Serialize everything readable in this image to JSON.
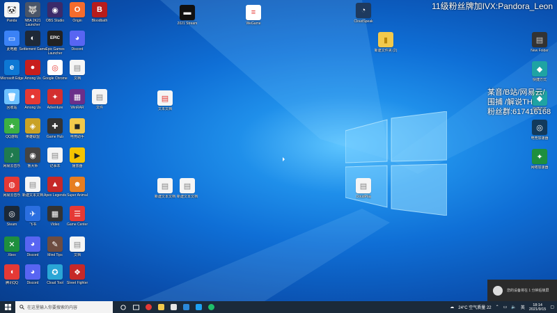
{
  "desktop": {
    "icons": [
      {
        "label": "Panda",
        "color": "#f5f5f5",
        "glyph": "🐼"
      },
      {
        "label": "NBA 2K21 Launcher",
        "color": "#4a5568",
        "glyph": "🐺"
      },
      {
        "label": "OBS Studio",
        "color": "#3b2a6a",
        "glyph": "◉"
      },
      {
        "label": "Origin",
        "color": "#f56c2d",
        "glyph": "O"
      },
      {
        "label": "Bloodbath",
        "color": "#b71c1c",
        "glyph": "B"
      },
      {
        "label": "2021 Stream",
        "color": "#111111",
        "glyph": "▬"
      },
      {
        "label": "WeGame",
        "color": "#ffffff",
        "glyph": "≡"
      },
      {
        "label": "CloudSpeak",
        "color": "#1e3a5f",
        "glyph": "◔"
      },
      {
        "label": "此电脑",
        "color": "#3b82f6",
        "glyph": "▭"
      },
      {
        "label": "Settlement Game",
        "color": "#1f2937",
        "glyph": "◐"
      },
      {
        "label": "Epic Games Launcher",
        "color": "#222222",
        "glyph": "EPIC"
      },
      {
        "label": "Discord",
        "color": "#5865f2",
        "glyph": "◕"
      },
      {
        "label": "新建文件夹 (2)",
        "color": "#f2c94c",
        "glyph": "▮"
      },
      {
        "label": "New Folder",
        "color": "#f5f5f5",
        "glyph": "▤"
      },
      {
        "label": "Microsoft Edge",
        "color": "#0e78d4",
        "glyph": "e"
      },
      {
        "label": "Among Us",
        "color": "#c81e1e",
        "glyph": "●"
      },
      {
        "label": "Google Chrome",
        "color": "#ffffff",
        "glyph": "◎"
      },
      {
        "label": "文档",
        "color": "#f5f5f5",
        "glyph": "▤"
      },
      {
        "label": "快捷方式",
        "color": "#1fa3a3",
        "glyph": "◆"
      },
      {
        "label": "回收站",
        "color": "#6ec1ff",
        "glyph": "🗑"
      },
      {
        "label": "Among Us",
        "color": "#e53935",
        "glyph": "●"
      },
      {
        "label": "Adventure",
        "color": "#d32f2f",
        "glyph": "✦"
      },
      {
        "label": "WinRAR",
        "color": "#6b2f8a",
        "glyph": "▦"
      },
      {
        "label": "文件",
        "color": "#f5f5f5",
        "glyph": "▤"
      },
      {
        "label": "文本文档",
        "color": "#f5f5f5",
        "glyph": "▤"
      },
      {
        "label": "QQ游戏",
        "color": "#3cb043",
        "glyph": "★"
      },
      {
        "label": "英雄联盟",
        "color": "#c9a227",
        "glyph": "◈"
      },
      {
        "label": "Game Hub",
        "color": "#333333",
        "glyph": "✚"
      },
      {
        "label": "电竞助手",
        "color": "#f2c94c",
        "glyph": "◼"
      },
      {
        "label": "网易云音乐",
        "color": "#1f7a4f",
        "glyph": "♪"
      },
      {
        "label": "鲁大师",
        "color": "#444444",
        "glyph": "◉"
      },
      {
        "label": "记事本",
        "color": "#f5f5f5",
        "glyph": "▤"
      },
      {
        "label": "播放器",
        "color": "#f5c400",
        "glyph": "▶"
      },
      {
        "label": "网易云音乐",
        "color": "#e53935",
        "glyph": "◍"
      },
      {
        "label": "新建文本文档",
        "color": "#f5f5f5",
        "glyph": "▤"
      },
      {
        "label": "Apex Legends",
        "color": "#c62828",
        "glyph": "▲"
      },
      {
        "label": "Super Animal",
        "color": "#e67e22",
        "glyph": "☻"
      },
      {
        "label": "文档",
        "color": "#f5f5f5",
        "glyph": "▤"
      },
      {
        "label": "Steam",
        "color": "#1b2838",
        "glyph": "◎"
      },
      {
        "label": "飞书",
        "color": "#2b6fe0",
        "glyph": "✈"
      },
      {
        "label": "Video",
        "color": "#333333",
        "glyph": "▦"
      },
      {
        "label": "Game Center",
        "color": "#e53935",
        "glyph": "☰"
      },
      {
        "label": "Xbox",
        "color": "#1e8f3e",
        "glyph": "✕"
      },
      {
        "label": "Discord",
        "color": "#5865f2",
        "glyph": "◕"
      },
      {
        "label": "Mind Tips",
        "color": "#6d4c41",
        "glyph": "✎"
      },
      {
        "label": "文档",
        "color": "#f5f5f5",
        "glyph": "▤"
      },
      {
        "label": "腾讯QQ",
        "color": "#e53935",
        "glyph": "◖"
      },
      {
        "label": "Discord",
        "color": "#5865f2",
        "glyph": "◕"
      },
      {
        "label": "Cloud Tool",
        "color": "#2aa6d6",
        "glyph": "✪"
      },
      {
        "label": "Street Fighter",
        "color": "#c62828",
        "glyph": "❖"
      },
      {
        "label": "快捷方式",
        "color": "#1fa3a3",
        "glyph": "◆"
      },
      {
        "label": "电竞加速器",
        "color": "#123a5c",
        "glyph": "◎"
      },
      {
        "label": "网络加速器",
        "color": "#1e8f3e",
        "glyph": "✦"
      },
      {
        "label": "素材",
        "color": "#f5f5f5",
        "glyph": "▤"
      },
      {
        "label": "新建文本文档",
        "color": "#f5f5f5",
        "glyph": "▤"
      },
      {
        "label": "新建文本文档",
        "color": "#f5f5f5",
        "glyph": "▤"
      },
      {
        "label": "CloudPlay",
        "color": "#f5f5f5",
        "glyph": "▤"
      }
    ]
  },
  "overlay": {
    "top": "11级粉丝牌加IVX:Pandora_Leon",
    "side1": "某音/B站/网易云/",
    "side2": "围捕 /解说TH",
    "side3": "粉丝群:617416168"
  },
  "toast": {
    "text": "您的设备将在 1 分钟后锁屏"
  },
  "taskbar": {
    "search_placeholder": "在这里输入你要搜索的内容",
    "weather": "24°C 空气质量 22",
    "time": "18:14",
    "date": "2021/9/15"
  }
}
